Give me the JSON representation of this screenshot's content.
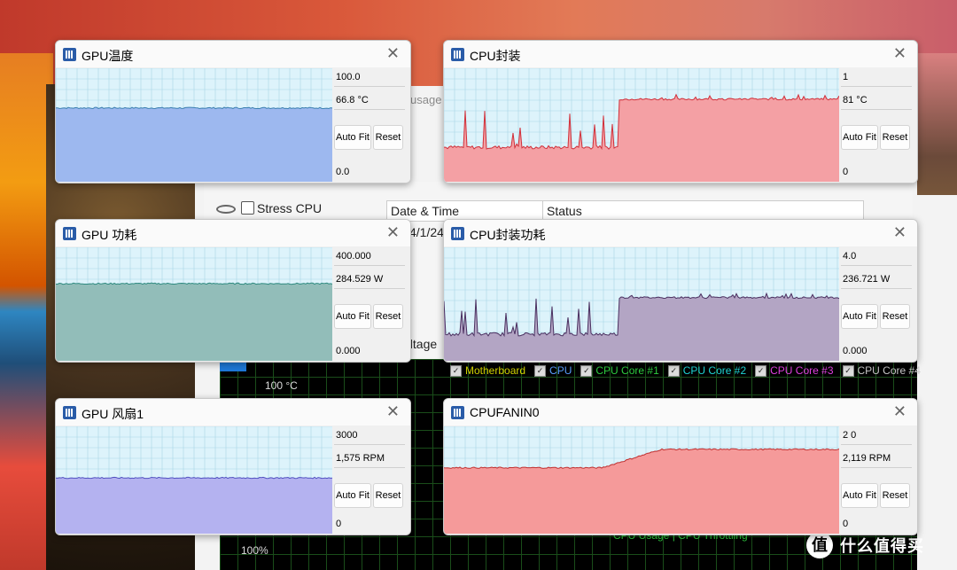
{
  "background": {
    "hwinfo_title_fragment": "usage",
    "stress_label": "Stress CPU",
    "table_header_date": "Date & Time",
    "table_header_status": "Status",
    "date_fragment": "4/1/24",
    "voltage_fragment": "oltage",
    "legend": [
      {
        "label": "Motherboard",
        "color": "#d4d400"
      },
      {
        "label": "CPU",
        "color": "#5aa0ff"
      },
      {
        "label": "CPU Core #1",
        "color": "#2ecc40"
      },
      {
        "label": "CPU Core #2",
        "color": "#1fd5d5"
      },
      {
        "label": "CPU Core #3",
        "color": "#e040e0"
      },
      {
        "label": "CPU Core #4",
        "color": "#c8c8c8"
      }
    ],
    "temp_axis": "100 °C",
    "pct_axis": "100%",
    "cpu_usage_label": "CPU Usage | CPU Throttling"
  },
  "watermark": {
    "logo": "值",
    "text": "什么值得买"
  },
  "windows": [
    {
      "title": "GPU温度",
      "max": "100.0",
      "cur": "66.8 °C",
      "min": "0.0",
      "auto_fit": "Auto Fit",
      "reset": "Reset",
      "level": 0.65,
      "fill": "#9db8ef",
      "line": "#3b7fb0",
      "pattern": "flat"
    },
    {
      "title": "CPU封装",
      "max": "1",
      "cur": "81 °C",
      "min": "0",
      "auto_fit": "Auto Fit",
      "reset": "Reset",
      "level": 0.72,
      "fill": "#f4a0a4",
      "line": "#d0303a",
      "pattern": "step-spiky"
    },
    {
      "title": "GPU 功耗",
      "max": "400.000",
      "cur": "284.529 W",
      "min": "0.000",
      "auto_fit": "Auto Fit",
      "reset": "Reset",
      "level": 0.68,
      "fill": "#92bdb9",
      "line": "#2e8a80",
      "pattern": "flat"
    },
    {
      "title": "CPU封装功耗",
      "max": "4.0",
      "cur": "236.721 W",
      "min": "0.000",
      "auto_fit": "Auto Fit",
      "reset": "Reset",
      "level": 0.55,
      "fill": "#b3a5c4",
      "line": "#4a3060",
      "pattern": "step-spiky"
    },
    {
      "title": "GPU 风扇1",
      "max": "3000",
      "cur": "1,575 RPM",
      "min": "0",
      "auto_fit": "Auto Fit",
      "reset": "Reset",
      "level": 0.52,
      "fill": "#b4b2f0",
      "line": "#5050c0",
      "pattern": "flat"
    },
    {
      "title": "CPUFANIN0",
      "max": "2 0",
      "cur": "2,119 RPM",
      "min": "0",
      "auto_fit": "Auto Fit",
      "reset": "Reset",
      "level": 0.78,
      "fill": "#f59a9a",
      "line": "#c03030",
      "pattern": "ramp"
    }
  ]
}
